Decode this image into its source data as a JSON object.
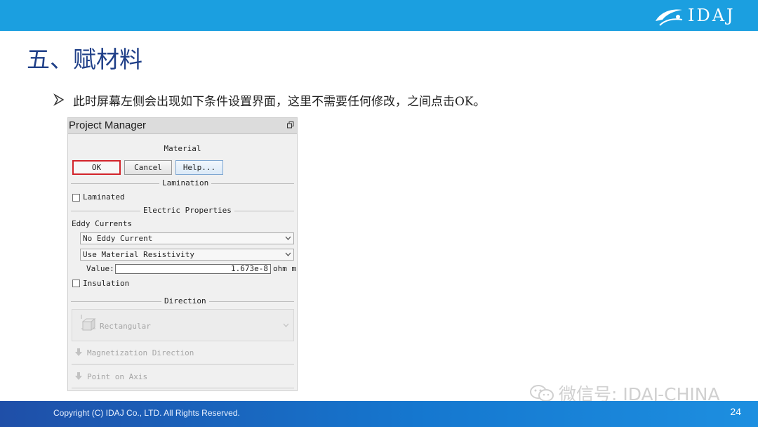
{
  "brand": {
    "logo_text": "IDAJ"
  },
  "slide": {
    "title": "五、赋材料",
    "bullet": "此时屏幕左侧会出现如下条件设置界面，这里不需要任何修改，之间点击OK。",
    "page_number": "24",
    "copyright": "Copyright (C) IDAJ Co., LTD. All Rights Reserved.",
    "watermark": "微信号: IDAJ-CHINA"
  },
  "panel": {
    "title": "Project Manager",
    "heading": "Material",
    "buttons": {
      "ok": "OK",
      "cancel": "Cancel",
      "help": "Help..."
    },
    "sections": {
      "lamination": "Lamination",
      "electric": "Electric Properties",
      "direction": "Direction"
    },
    "laminated": {
      "label": "Laminated",
      "checked": false
    },
    "eddy_label": "Eddy Currents",
    "eddy_select": "No Eddy Current",
    "resistivity_select": "Use Material Resistivity",
    "value_label": "Value:",
    "value": "1.673e-8",
    "value_unit": "ohm m",
    "insulation": {
      "label": "Insulation",
      "checked": false
    },
    "direction_select": "Rectangular",
    "magnetization_label": "Magnetization Direction",
    "point_label": "Point on Axis"
  },
  "colors": {
    "topbar": "#1b9fe0",
    "title": "#1f3f88",
    "ok_border": "#d2232a",
    "footer": "#1f4fa8"
  }
}
